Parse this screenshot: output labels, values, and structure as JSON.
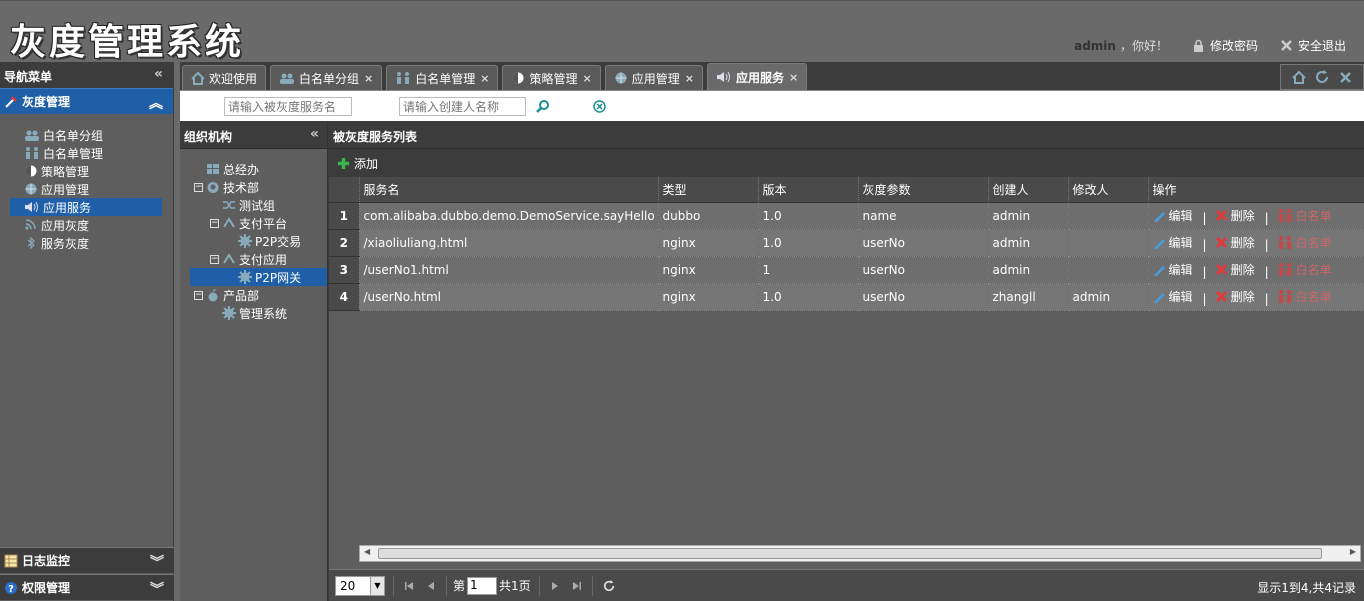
{
  "app": {
    "title": "灰度管理系统"
  },
  "user": {
    "name": "admin",
    "greeting": "，你好！",
    "change_password": "修改密码",
    "logout": "安全退出"
  },
  "sidebar": {
    "title": "导航菜单",
    "section": "灰度管理",
    "items": [
      {
        "label": "白名单分组",
        "icon": "users-icon"
      },
      {
        "label": "白名单管理",
        "icon": "people-icon"
      },
      {
        "label": "策略管理",
        "icon": "contrast-icon"
      },
      {
        "label": "应用管理",
        "icon": "globe-icon"
      },
      {
        "label": "应用服务",
        "icon": "speaker-icon"
      },
      {
        "label": "应用灰度",
        "icon": "rss-icon"
      },
      {
        "label": "服务灰度",
        "icon": "bluetooth-icon"
      }
    ],
    "bottom": [
      {
        "label": "日志监控"
      },
      {
        "label": "权限管理"
      }
    ]
  },
  "tabs": [
    {
      "label": "欢迎使用",
      "closable": false
    },
    {
      "label": "白名单分组",
      "closable": true
    },
    {
      "label": "白名单管理",
      "closable": true
    },
    {
      "label": "策略管理",
      "closable": true
    },
    {
      "label": "应用管理",
      "closable": true
    },
    {
      "label": "应用服务",
      "closable": true,
      "active": true
    }
  ],
  "search": {
    "service_placeholder": "请输入被灰度服务名",
    "creator_placeholder": "请输入创建人名称"
  },
  "org": {
    "title": "组织机构",
    "nodes": [
      {
        "label": "总经办"
      },
      {
        "label": "技术部"
      },
      {
        "label": "测试组"
      },
      {
        "label": "支付平台"
      },
      {
        "label": "P2P交易"
      },
      {
        "label": "支付应用"
      },
      {
        "label": "P2P网关"
      },
      {
        "label": "产品部"
      },
      {
        "label": "管理系统"
      }
    ]
  },
  "list": {
    "title": "被灰度服务列表",
    "add_label": "添加",
    "columns": [
      "服务名",
      "类型",
      "版本",
      "灰度参数",
      "创建人",
      "修改人",
      "操作"
    ],
    "rows": [
      {
        "no": "1",
        "service": "com.alibaba.dubbo.demo.DemoService.sayHello",
        "type": "dubbo",
        "version": "1.0",
        "param": "name",
        "creator": "admin",
        "modifier": ""
      },
      {
        "no": "2",
        "service": "/xiaoliuliang.html",
        "type": "nginx",
        "version": "1.0",
        "param": "userNo",
        "creator": "admin",
        "modifier": ""
      },
      {
        "no": "3",
        "service": "/userNo1.html",
        "type": "nginx",
        "version": "1",
        "param": "userNo",
        "creator": "admin",
        "modifier": ""
      },
      {
        "no": "4",
        "service": "/userNo.html",
        "type": "nginx",
        "version": "1.0",
        "param": "userNo",
        "creator": "zhangll",
        "modifier": "admin"
      }
    ],
    "ops": {
      "edit": "编辑",
      "delete": "删除",
      "whitelist": "白名单"
    }
  },
  "pager": {
    "page_size": "20",
    "page_prefix": "第",
    "page": "1",
    "page_suffix": "共1页",
    "info": "显示1到4,共4记录"
  }
}
